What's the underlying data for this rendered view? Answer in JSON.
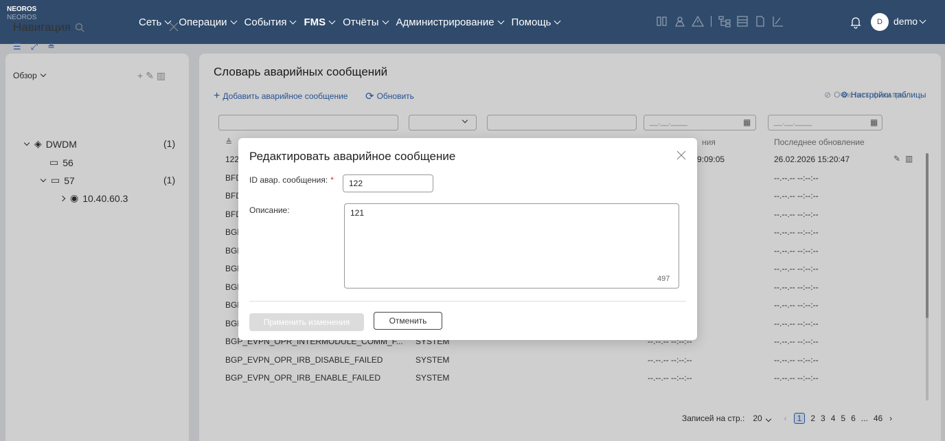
{
  "header": {
    "brand": "NEOROS",
    "brand_sub": "NEOROS",
    "menu": [
      {
        "label": "Сеть"
      },
      {
        "label": "Операции"
      },
      {
        "label": "События"
      },
      {
        "label": "FMS"
      },
      {
        "label": "Отчёты"
      },
      {
        "label": "Администрирование"
      },
      {
        "label": "Помощь"
      }
    ],
    "avatar_letter": "D",
    "user": "demo"
  },
  "nav": {
    "title": "Навигация",
    "overview": "Обзор",
    "tree": [
      {
        "label": "DWDM",
        "count": "(1)"
      },
      {
        "label": "56"
      },
      {
        "label": "57",
        "count": "(1)"
      },
      {
        "label": "10.40.60.3"
      }
    ]
  },
  "main": {
    "title": "Словарь аварийных сообщений",
    "add_label": "Добавить аварийное сообщение",
    "refresh_label": "Обновить",
    "clear_filters": "Очистить фильтры",
    "table_settings": "Настройки таблицы",
    "date_placeholder": "__.__.____",
    "headers": {
      "created_partial": "ния",
      "updated": "Последнее обновление"
    },
    "rows": [
      {
        "id": "122",
        "source": "",
        "created": "9:09:05",
        "updated": "26.02.2026 15:20:47"
      },
      {
        "id": "BFD",
        "source": "",
        "created": "",
        "updated": "--.--.-- --:--:--"
      },
      {
        "id": "BFD",
        "source": "",
        "created": "",
        "updated": "--.--.-- --:--:--"
      },
      {
        "id": "BFD",
        "source": "",
        "created": "",
        "updated": "--.--.-- --:--:--"
      },
      {
        "id": "BGP",
        "source": "",
        "created": "",
        "updated": "--.--.-- --:--:--"
      },
      {
        "id": "BGP",
        "source": "",
        "created": "",
        "updated": "--.--.-- --:--:--"
      },
      {
        "id": "BGP",
        "source": "",
        "created": "",
        "updated": "--.--.-- --:--:--"
      },
      {
        "id": "BGP",
        "source": "",
        "created": "",
        "updated": "--.--.-- --:--:--"
      },
      {
        "id": "BGP",
        "source": "",
        "created": "",
        "updated": "--.--.-- --:--:--"
      },
      {
        "id": "BGP",
        "source": "",
        "created": "",
        "updated": "--.--.-- --:--:--"
      },
      {
        "id": "BGP_EVPN_OPR_INTERMODULE_COMM_F...",
        "source": "SYSTEM",
        "created": "--.--.-- --:--:--",
        "updated": "--.--.-- --:--:--"
      },
      {
        "id": "BGP_EVPN_OPR_IRB_DISABLE_FAILED",
        "source": "SYSTEM",
        "created": "--.--.-- --:--:--",
        "updated": "--.--.-- --:--:--"
      },
      {
        "id": "BGP_EVPN_OPR_IRB_ENABLE_FAILED",
        "source": "SYSTEM",
        "created": "--.--.-- --:--:--",
        "updated": "--.--.-- --:--:--"
      }
    ],
    "pager": {
      "label": "Записей на стр.:",
      "per_page": "20",
      "pages": [
        "1",
        "2",
        "3",
        "4",
        "5",
        "6",
        "...",
        "46"
      ]
    }
  },
  "modal": {
    "title": "Редактировать аварийное сообщение",
    "id_label": "ID авар. сообщения:",
    "required_mark": "*",
    "id_value": "122",
    "desc_label": "Описание:",
    "desc_value": "121",
    "char_count": "497",
    "apply_label": "Применить изменения",
    "cancel_label": "Отменить"
  }
}
